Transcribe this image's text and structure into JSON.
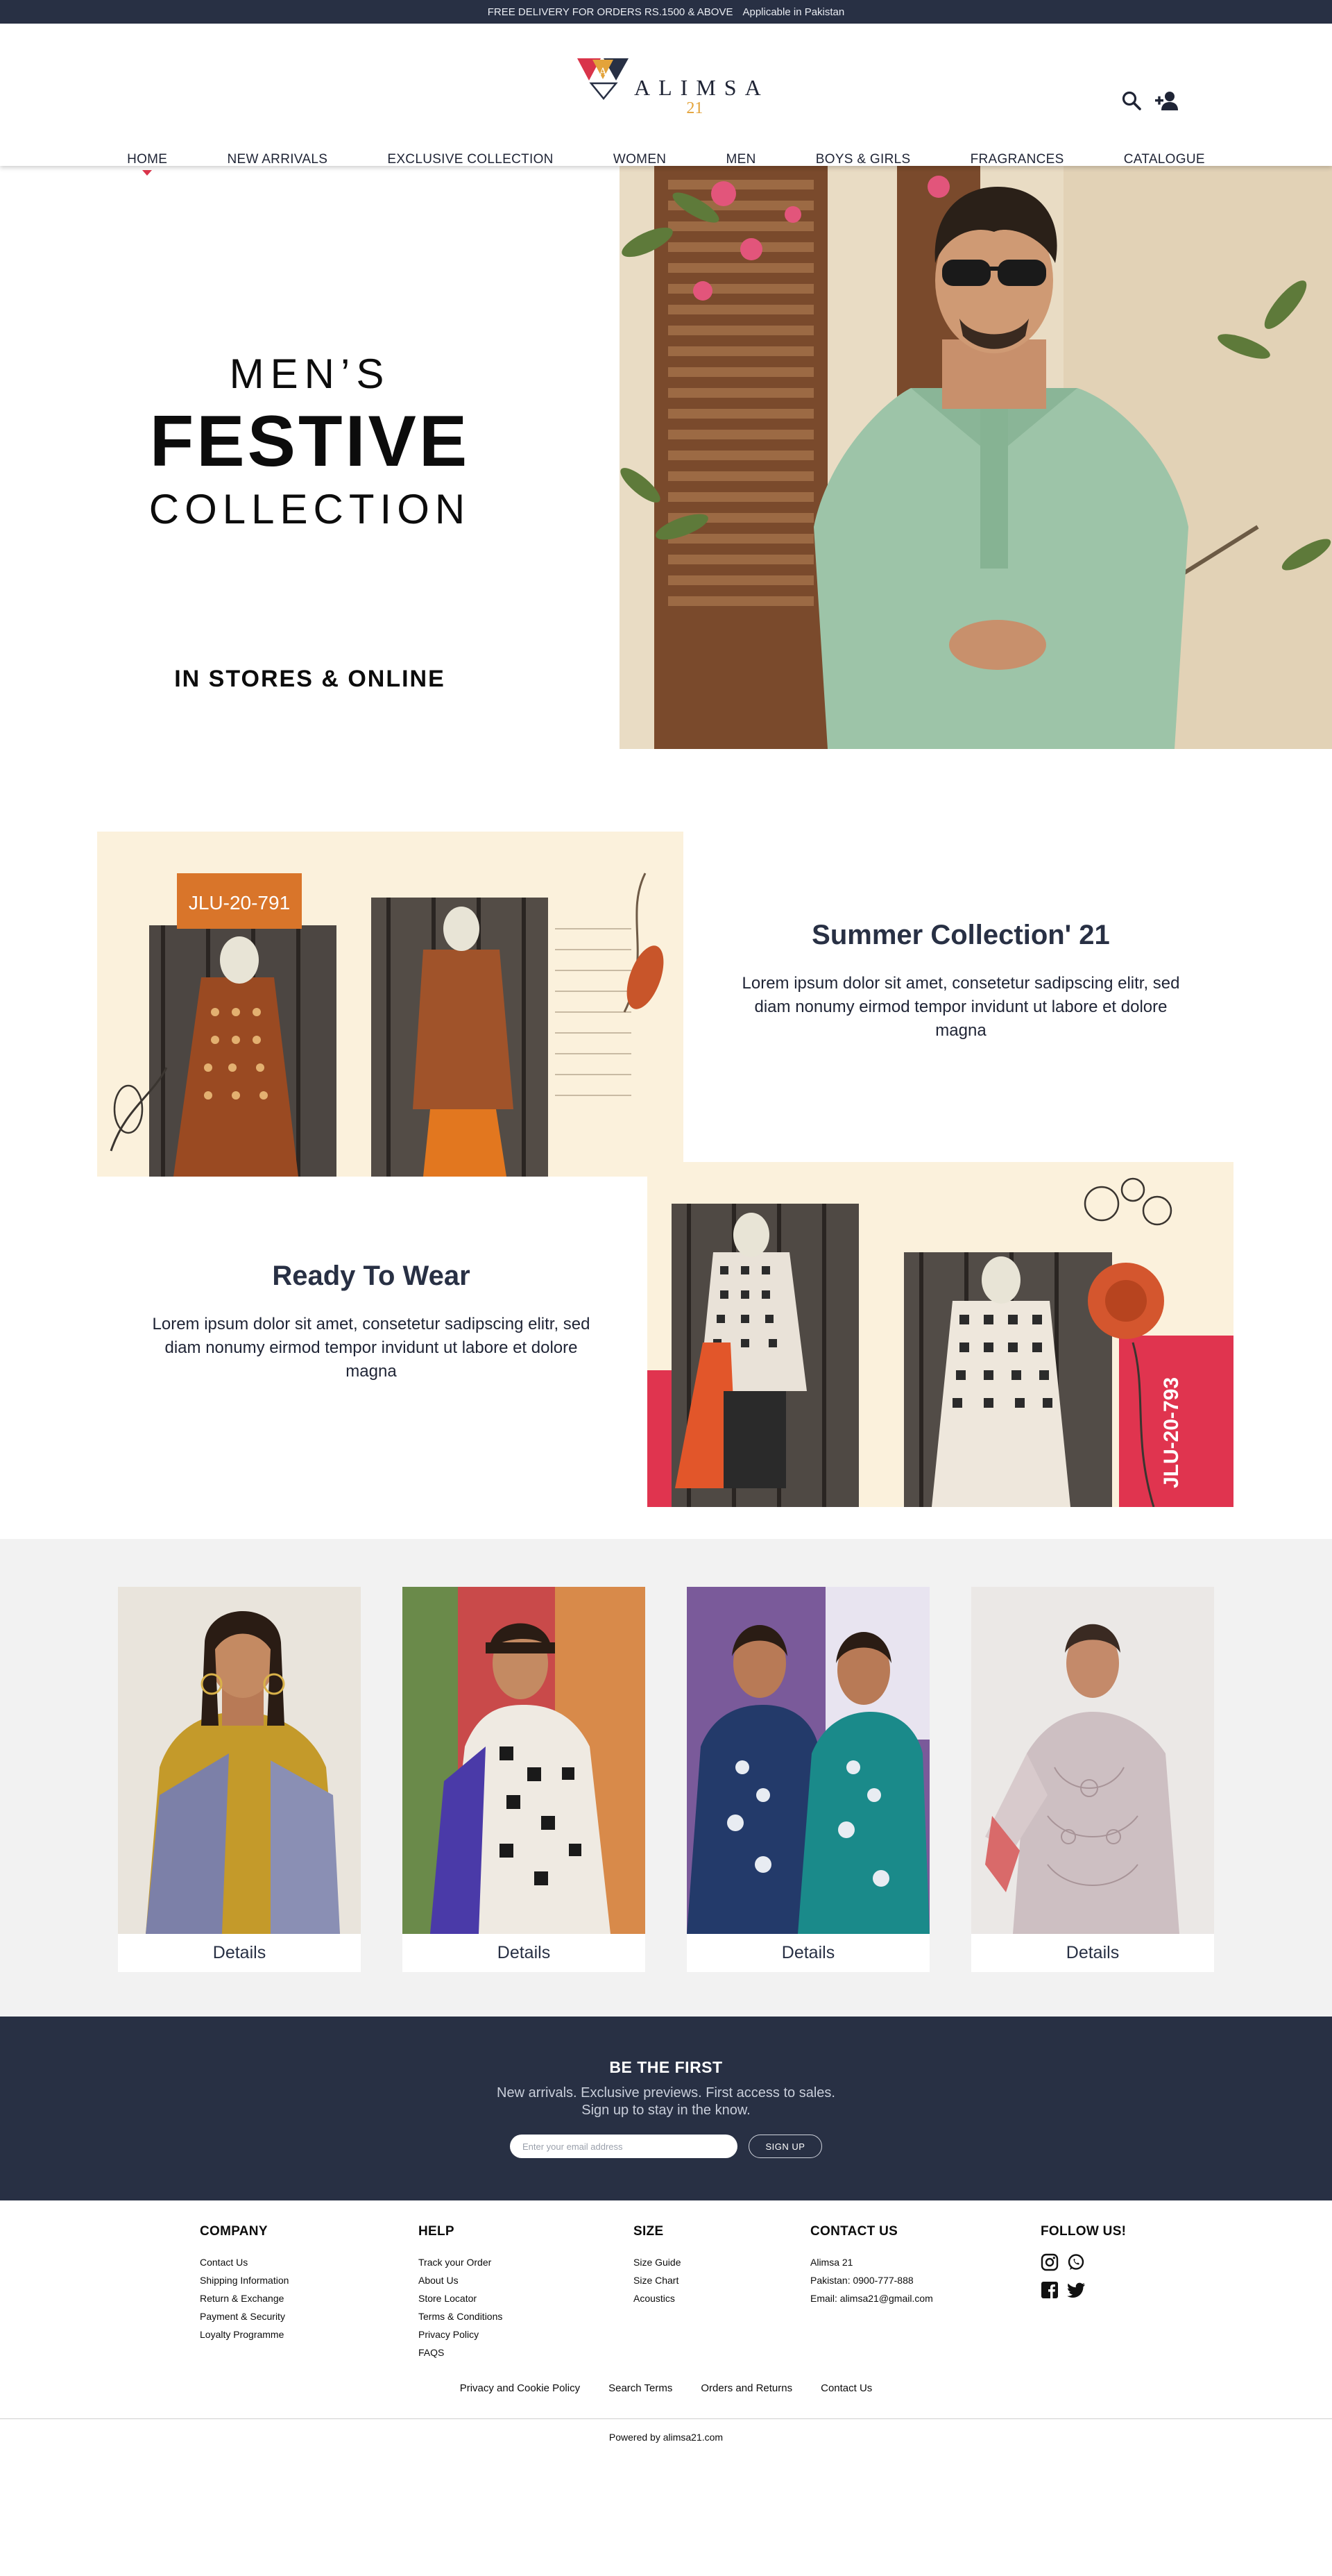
{
  "promo": {
    "main": "FREE DELIVERY FOR ORDERS RS.1500 & ABOVE",
    "note": "Applicable in Pakistan"
  },
  "brand": {
    "name": "ALIMSA",
    "number": "21",
    "colors": {
      "navy": "#283044",
      "red": "#d9344a",
      "gold": "#e3a33a"
    }
  },
  "header_icons": [
    "search-icon",
    "add-user-icon"
  ],
  "nav": [
    {
      "label": "HOME",
      "active": true
    },
    {
      "label": "NEW ARRIVALS"
    },
    {
      "label": "EXCLUSIVE COLLECTION"
    },
    {
      "label": "WOMEN"
    },
    {
      "label": "MEN"
    },
    {
      "label": "BOYS & GIRLS"
    },
    {
      "label": "FRAGRANCES"
    },
    {
      "label": "CATALOGUE"
    }
  ],
  "hero": {
    "line1": "MEN’S",
    "line2": "FESTIVE",
    "line3": "COLLECTION",
    "tagline": "IN STORES & ONLINE"
  },
  "features": [
    {
      "title": "Summer Collection' 21",
      "body": "Lorem ipsum dolor sit amet, consetetur sadipscing elitr, sed diam nonumy eirmod tempor invidunt ut labore et dolore magna",
      "tag": "JLU-20-791",
      "tag_color": "#d9752a"
    },
    {
      "title": "Ready To Wear",
      "body": "Lorem ipsum dolor sit amet, consetetur sadipscing elitr, sed diam nonumy eirmod tempor invidunt ut labore et dolore magna",
      "tag": "JLU-20-793",
      "tag_color": "#e0344f"
    }
  ],
  "products": [
    {
      "button": "Details"
    },
    {
      "button": "Details"
    },
    {
      "button": "Details"
    },
    {
      "button": "Details"
    }
  ],
  "newsletter": {
    "title": "BE THE FIRST",
    "line1": "New arrivals. Exclusive previews. First access to sales.",
    "line2": "Sign up to stay in the know.",
    "placeholder": "Enter your email address",
    "button": "SIGN UP"
  },
  "footer": {
    "company": {
      "title": "COMPANY",
      "links": [
        "Contact Us",
        "Shipping Information",
        "Return & Exchange",
        "Payment & Security",
        "Loyalty Programme"
      ]
    },
    "help": {
      "title": "HELP",
      "links": [
        "Track your Order",
        "About Us",
        "Store Locator",
        "Terms & Conditions",
        "Privacy Policy",
        "FAQS"
      ]
    },
    "size": {
      "title": "SIZE",
      "links": [
        "Size Guide",
        "Size Chart",
        "Acoustics"
      ]
    },
    "contact": {
      "title": "CONTACT US",
      "lines": [
        "Alimsa 21",
        "Pakistan: 0900-777-888",
        "Email: alimsa21@gmail.com"
      ]
    },
    "follow": {
      "title": "FOLLOW US!",
      "icons": [
        "instagram-icon",
        "whatsapp-icon",
        "facebook-icon",
        "twitter-icon"
      ]
    },
    "legal": [
      "Privacy and Cookie Policy",
      "Search Terms",
      "Orders and Returns",
      "Contact Us"
    ],
    "powered": "Powered by alimsa21.com"
  }
}
